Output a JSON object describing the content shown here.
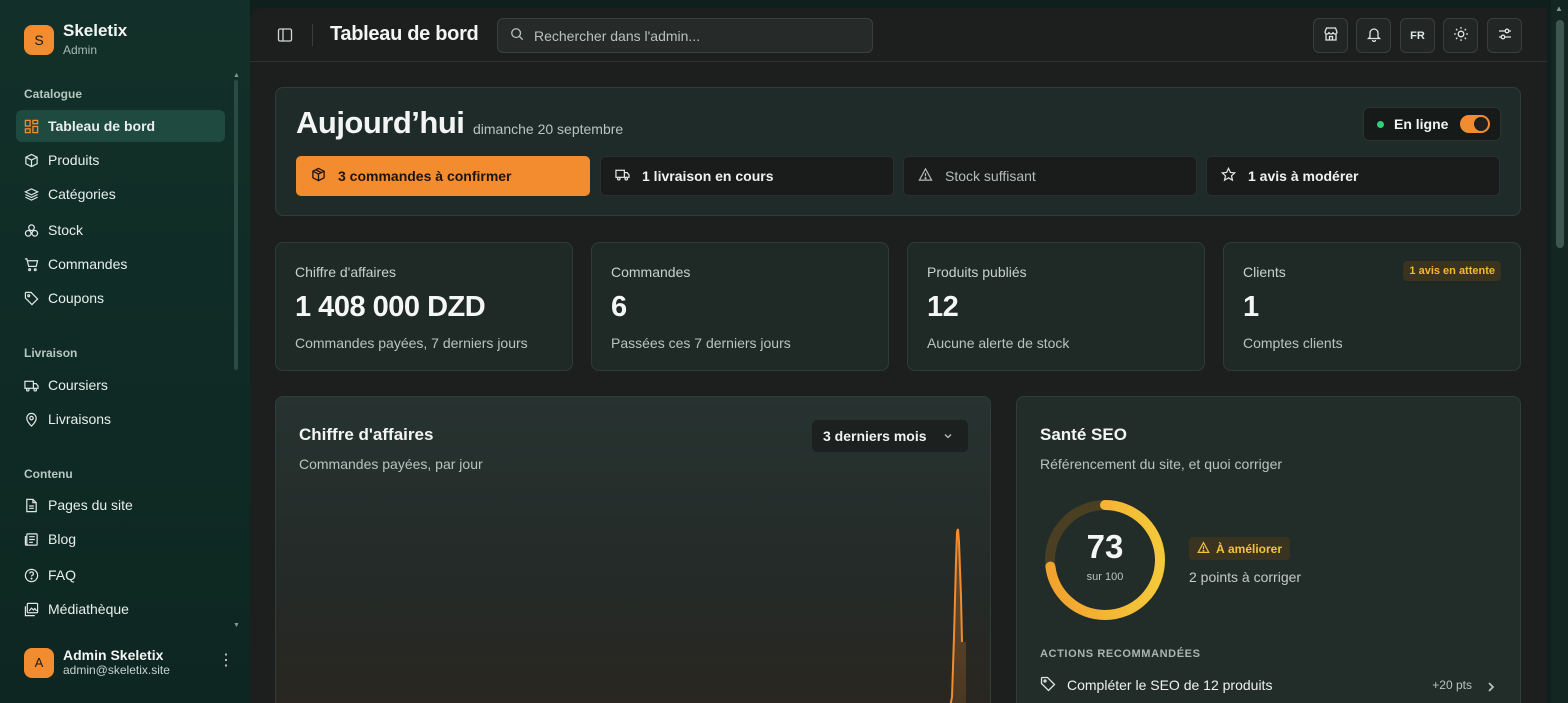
{
  "brand": {
    "logo_letter": "S",
    "name": "Skeletix",
    "role": "Admin"
  },
  "sidebar": {
    "sections": [
      {
        "title": "Catalogue"
      },
      {
        "title": "Livraison"
      },
      {
        "title": "Contenu"
      }
    ],
    "items": [
      {
        "label": "Tableau de bord",
        "icon": "dashboard-icon",
        "active": true
      },
      {
        "label": "Produits",
        "icon": "box-icon"
      },
      {
        "label": "Catégories",
        "icon": "layers-icon"
      },
      {
        "label": "Stock",
        "icon": "boxes-icon"
      },
      {
        "label": "Commandes",
        "icon": "cart-icon"
      },
      {
        "label": "Coupons",
        "icon": "tag-icon"
      },
      {
        "label": "Coursiers",
        "icon": "truck-icon"
      },
      {
        "label": "Livraisons",
        "icon": "map-pin-icon"
      },
      {
        "label": "Pages du site",
        "icon": "file-icon"
      },
      {
        "label": "Blog",
        "icon": "newspaper-icon"
      },
      {
        "label": "FAQ",
        "icon": "help-circle-icon"
      },
      {
        "label": "Médiathèque",
        "icon": "images-icon"
      }
    ]
  },
  "user": {
    "avatar_letter": "A",
    "name": "Admin Skeletix",
    "email": "admin@skeletix.site"
  },
  "topbar": {
    "title": "Tableau de bord",
    "search_placeholder": "Rechercher dans l'admin...",
    "lang": "FR"
  },
  "today": {
    "title": "Aujourd’hui",
    "date": "dimanche 20 septembre",
    "status_label": "En ligne",
    "status_on": true,
    "pills": [
      {
        "label": "3 commandes à confirmer",
        "icon": "package-icon"
      },
      {
        "label": "1 livraison en cours",
        "icon": "truck-icon"
      },
      {
        "label": "Stock suffisant",
        "icon": "warning-icon"
      },
      {
        "label": "1 avis à modérer",
        "icon": "star-icon"
      }
    ]
  },
  "kpis": [
    {
      "label": "Chiffre d'affaires",
      "value": "1 408 000 DZD",
      "sub": "Commandes payées, 7 derniers jours"
    },
    {
      "label": "Commandes",
      "value": "6",
      "sub": "Passées ces 7 derniers jours"
    },
    {
      "label": "Produits publiés",
      "value": "12",
      "sub": "Aucune alerte de stock"
    },
    {
      "label": "Clients",
      "value": "1",
      "sub": "Comptes clients",
      "badge": "1 avis en attente"
    }
  ],
  "revenue": {
    "title": "Chiffre d'affaires",
    "subtitle": "Commandes payées, par jour",
    "period": "3 derniers mois",
    "line_color": "#f28c2e"
  },
  "seo": {
    "title": "Santé SEO",
    "subtitle": "Référencement du site, et quoi corriger",
    "score": "73",
    "score_of": "sur 100",
    "score_fraction": 0.73,
    "status": "À améliorer",
    "points": "2 points à corriger",
    "actions_title": "ACTIONS RECOMMANDÉES",
    "actions": [
      {
        "label": "Compléter le SEO de 12 produits",
        "points": "+20 pts"
      }
    ]
  },
  "colors": {
    "accent": "#f28c2e",
    "online": "#2fd07a",
    "warning": "#f5b82e"
  }
}
